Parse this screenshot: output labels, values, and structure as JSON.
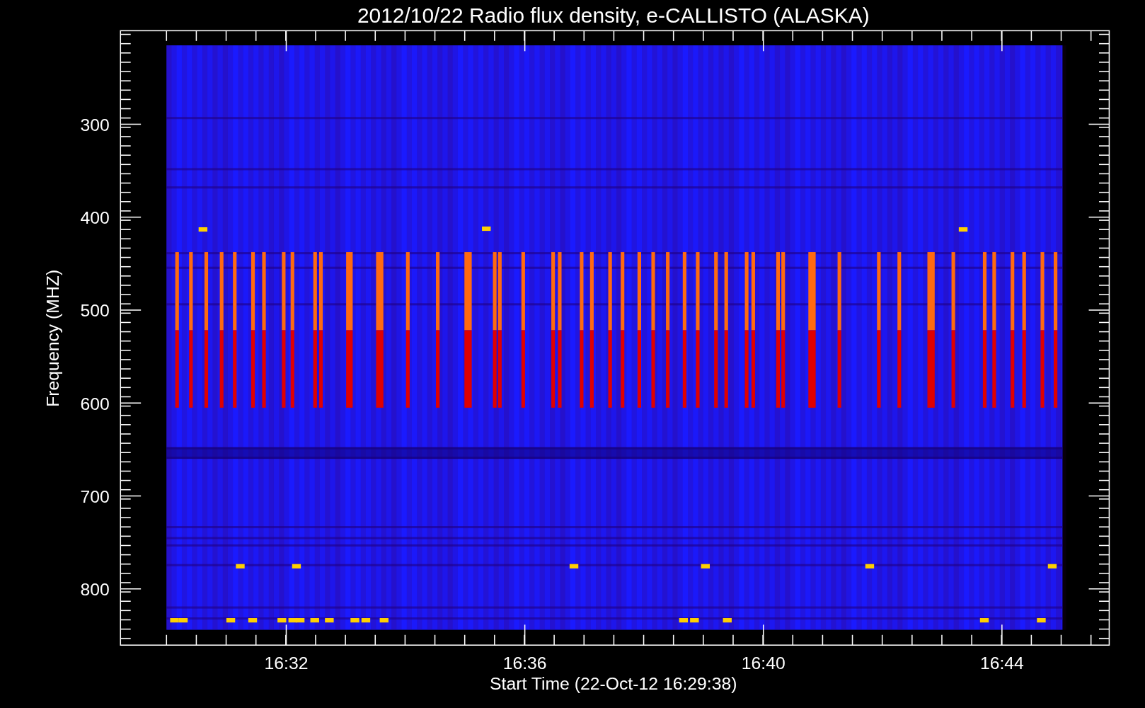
{
  "title": "2012/10/22  Radio flux density, e-CALLISTO (ALASKA)",
  "y_axis": {
    "label": "Frequency (MHZ)",
    "ticks": [
      "300",
      "400",
      "500",
      "600",
      "700",
      "800"
    ]
  },
  "x_axis": {
    "label": "Start Time (22-Oct-12 16:29:38)",
    "ticks": [
      "16:32",
      "16:36",
      "16:40",
      "16:44"
    ]
  }
}
